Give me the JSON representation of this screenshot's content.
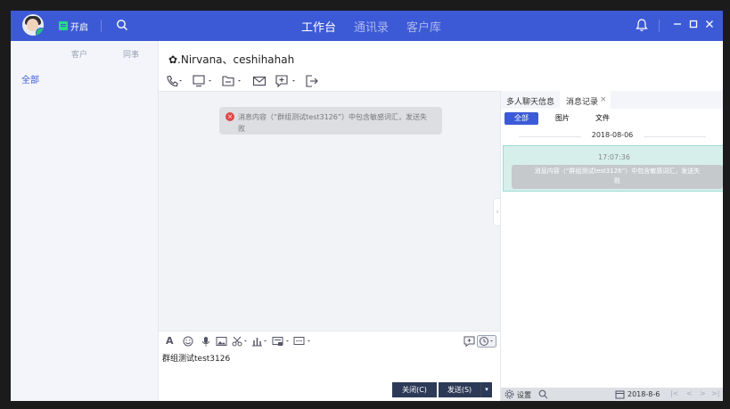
{
  "topbar": {
    "status_label": "开启",
    "nav_tabs": [
      {
        "label": "工作台",
        "active": true
      },
      {
        "label": "通讯录",
        "active": false
      },
      {
        "label": "客户库",
        "active": false
      }
    ]
  },
  "sidebar": {
    "tabs": [
      "客户",
      "同事"
    ],
    "filter": "全部"
  },
  "chat": {
    "title": "Nirvana、ceshihahah",
    "system_message_line1": "消息内容（“群组测试test3126”）中包含敏感词汇，发送失",
    "system_message_line2": "败",
    "draft": "群组测试test3126",
    "close_label": "关闭(C)",
    "send_label": "发送(S)"
  },
  "right_panel": {
    "tabs": [
      {
        "label": "多人聊天信息",
        "active": false
      },
      {
        "label": "消息记录",
        "active": true
      }
    ],
    "filters": [
      {
        "label": "全部",
        "active": true
      },
      {
        "label": "图片",
        "active": false
      },
      {
        "label": "文件",
        "active": false
      }
    ],
    "date": "2018-08-06",
    "record_time": "17:07:36",
    "record_line1": "消息内容（“群组测试test3126”）中包含敏感词汇，发送失",
    "record_line2": "败",
    "footer": {
      "settings_label": "设置",
      "date_label": "2018-8-6"
    }
  },
  "colors": {
    "accent": "#3d5ad6",
    "selected_record": "#d6efeb",
    "error": "#e04848"
  }
}
